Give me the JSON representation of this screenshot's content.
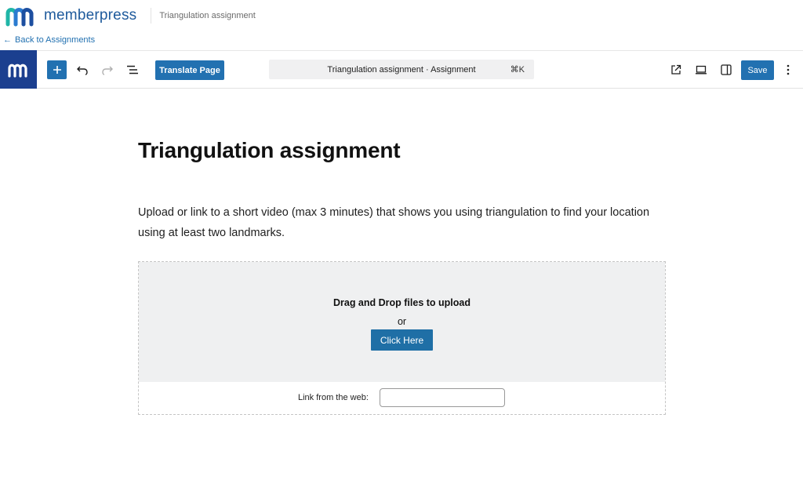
{
  "brand": {
    "name": "memberpress",
    "context": "Triangulation assignment"
  },
  "nav": {
    "back_arrow": "←",
    "back_label": "Back to Assignments"
  },
  "toolbar": {
    "add_icon": "plus-icon",
    "undo_icon": "undo-icon",
    "redo_icon": "redo-icon",
    "list_view_icon": "list-view-icon",
    "translate_label": "Translate Page",
    "command_title": "Triangulation assignment · Assignment",
    "command_shortcut": "⌘K",
    "view_icon": "external-link-icon",
    "preview_icon": "desktop-preview-icon",
    "sidebar_icon": "sidebar-toggle-icon",
    "save_label": "Save",
    "more_icon": "more-vertical-icon"
  },
  "content": {
    "title": "Triangulation assignment",
    "description": "Upload or link to a short video (max 3 minutes) that shows you using triangulation to find your location using at least two landmarks."
  },
  "upload": {
    "drop_title": "Drag and Drop files to upload",
    "or_text": "or",
    "button_label": "Click Here",
    "link_label": "Link from the web:",
    "link_value": ""
  },
  "colors": {
    "accent": "#2271b1",
    "brand_dark": "#1b3f8f",
    "drop_zone_bg": "#eff0f1"
  }
}
